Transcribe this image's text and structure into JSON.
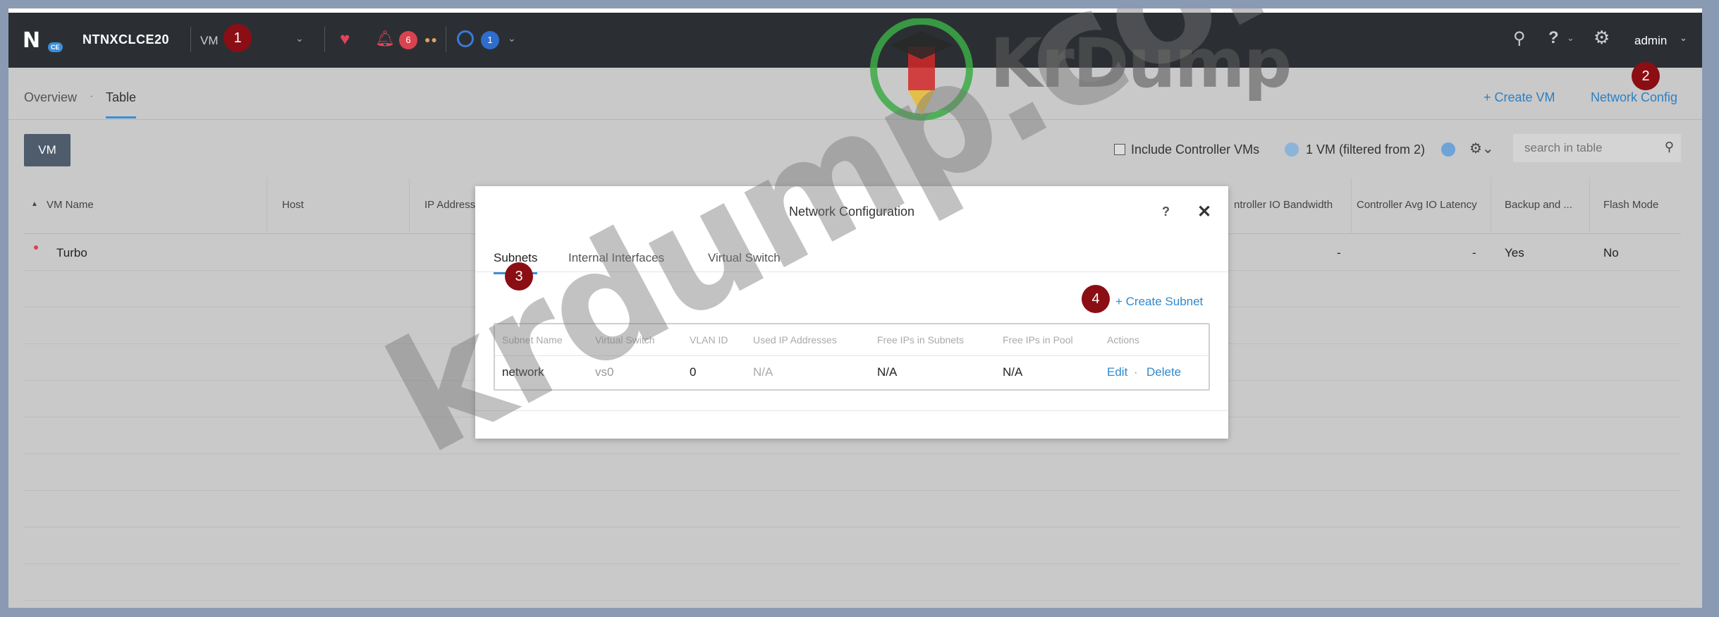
{
  "topbar": {
    "cluster_name": "NTNXCLCE20",
    "logo_text": "N",
    "logo_badge": "CE",
    "nav_item": "VM",
    "alerts_count": "6",
    "tasks_count": "1",
    "user": "admin"
  },
  "subnav": {
    "tabs": [
      "Overview",
      "Table"
    ],
    "active_tab": "Table",
    "create_vm": "+ Create VM",
    "network_config": "Network Config"
  },
  "toolbar": {
    "vm_button": "VM",
    "include_cvm_label": "Include Controller VMs",
    "filter_status": "1 VM (filtered from 2)",
    "search_placeholder": "search in table"
  },
  "table": {
    "headers": [
      "VM Name",
      "Host",
      "IP Addresses",
      "ntroller IO Bandwidth",
      "Controller Avg IO Latency",
      "Backup and ...",
      "Flash Mode"
    ],
    "rows": [
      {
        "name": "Turbo",
        "io_bandwidth": "-",
        "io_latency": "-",
        "backup": "Yes",
        "flash_mode": "No"
      }
    ]
  },
  "modal": {
    "title": "Network Configuration",
    "help": "?",
    "close": "✕",
    "tabs": [
      "Subnets",
      "Internal Interfaces",
      "Virtual Switch"
    ],
    "active_tab": "Subnets",
    "create_subnet": "+ Create Subnet",
    "columns": [
      "Subnet Name",
      "Virtual Switch",
      "VLAN ID",
      "Used IP Addresses",
      "Free IPs in Subnets",
      "Free IPs in Pool",
      "Actions"
    ],
    "rows": [
      {
        "subnet_name": "network",
        "virtual_switch": "vs0",
        "vlan_id": "0",
        "used_ips": "N/A",
        "free_subnet": "N/A",
        "free_pool": "N/A",
        "edit": "Edit",
        "delete": "Delete"
      }
    ]
  },
  "markers": [
    "1",
    "2",
    "3",
    "4"
  ],
  "watermark": {
    "brand": "KrDump",
    "diagonal": "krdump.com"
  },
  "colors": {
    "topbar": "#2b2f33",
    "accent": "#3b8fd6",
    "marker": "#8a0e14",
    "alert": "#d9434f"
  }
}
